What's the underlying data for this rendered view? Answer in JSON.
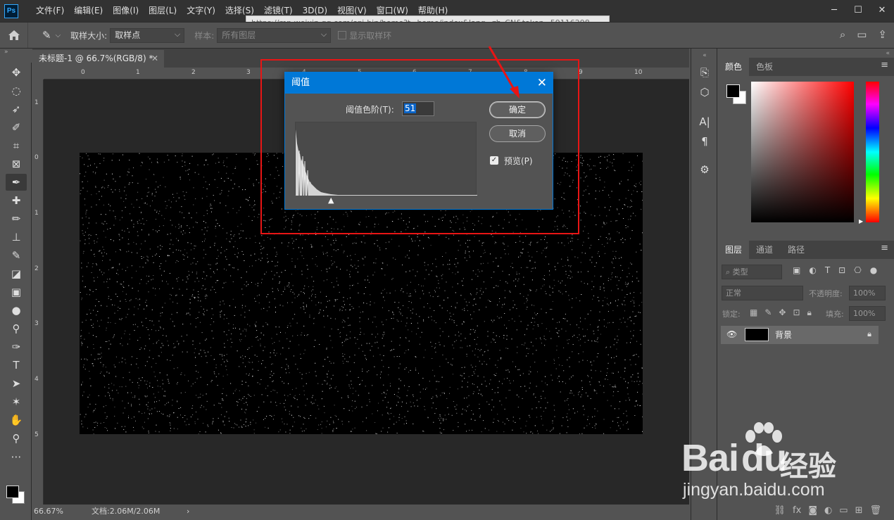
{
  "app": {
    "logo": "Ps",
    "menu": [
      "文件(F)",
      "编辑(E)",
      "图像(I)",
      "图层(L)",
      "文字(Y)",
      "选择(S)",
      "滤镜(T)",
      "3D(D)",
      "视图(V)",
      "窗口(W)",
      "帮助(H)"
    ],
    "url_tooltip": "https://mp.weixin.qq.com/cgi-bin/home?t=home/index&lang=zh_CN&token=59116298"
  },
  "options": {
    "sample_size_label": "取样大小:",
    "sample_size_value": "取样点",
    "sample_label": "样本:",
    "sample_value": "所有图层",
    "show_ring_label": "显示取样环"
  },
  "document": {
    "tab_title": "未标题-1 @ 66.7%(RGB/8) *",
    "ruler_top": [
      "0",
      "1",
      "2",
      "3",
      "4",
      "5",
      "6",
      "7",
      "8",
      "9",
      "10"
    ],
    "ruler_left": [
      "1",
      "0",
      "1",
      "2",
      "3",
      "4",
      "5"
    ],
    "zoom": "66.67%",
    "doc_info": "文档:2.06M/2.06M"
  },
  "dialog": {
    "title": "阈值",
    "level_label": "阈值色阶(T):",
    "level_value": "51",
    "ok_label": "确定",
    "cancel_label": "取消",
    "preview_label": "预览(P)",
    "preview_checked": true
  },
  "color_panel": {
    "tabs": [
      "颜色",
      "色板"
    ]
  },
  "layers_panel": {
    "tabs": [
      "图层",
      "通道",
      "路径"
    ],
    "filter_label": "类型",
    "blend_mode": "正常",
    "opacity_label": "不透明度:",
    "opacity_value": "100%",
    "lock_label": "锁定:",
    "fill_label": "填充:",
    "fill_value": "100%",
    "layers": [
      {
        "name": "背景"
      }
    ]
  },
  "watermark": {
    "brand": "Bai",
    "brand2": "du",
    "cn": "经验",
    "url": "jingyan.baidu.com"
  },
  "colors": {
    "accent": "#0078d7",
    "annotation_red": "#e81515"
  }
}
